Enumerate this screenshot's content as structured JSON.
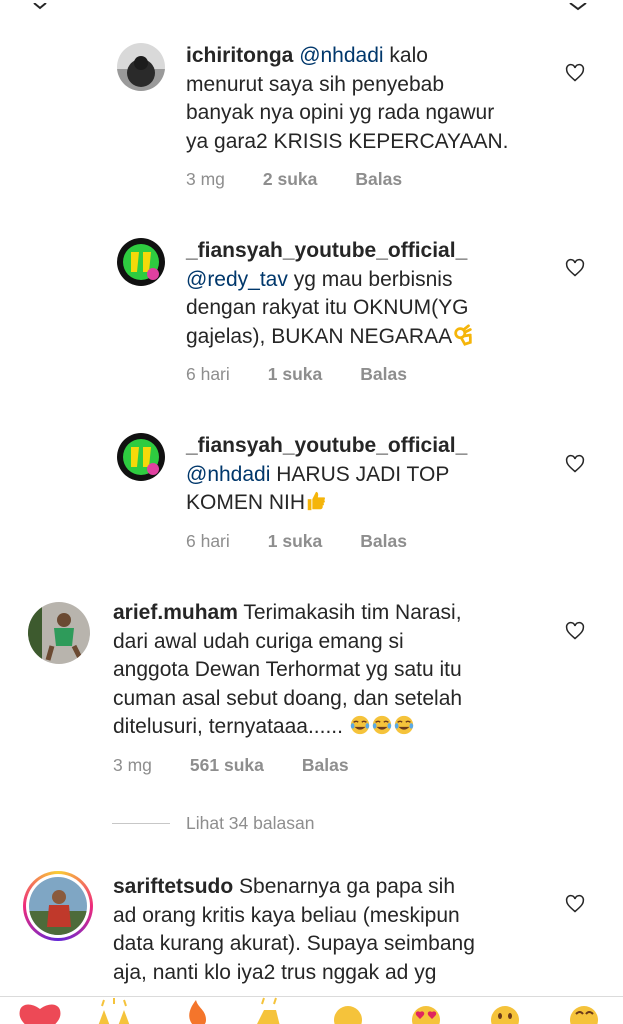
{
  "comments": [
    {
      "username": "ichiritonga",
      "mention": "@nhdadi",
      "text_lines": [
        " kalo",
        "menurut saya sih penyebab",
        "banyak nya opini yg rada ngawur",
        "ya gara2 KRISIS KEPERCAYAAN."
      ],
      "time": "3 mg",
      "likes": "2 suka",
      "reply": "Balas"
    },
    {
      "username": "_fiansyah_youtube_official_",
      "mention": "@redy_tav",
      "text_lines": [
        " yg mau berbisnis",
        "dengan rakyat itu OKNUM(YG",
        "gajelas), BUKAN NEGARAA"
      ],
      "time": "6 hari",
      "likes": "1 suka",
      "reply": "Balas"
    },
    {
      "username": "_fiansyah_youtube_official_",
      "mention": "@nhdadi",
      "text_lines": [
        " HARUS JADI TOP",
        "KOMEN NIH"
      ],
      "time": "6 hari",
      "likes": "1 suka",
      "reply": "Balas"
    },
    {
      "username": "arief.muham",
      "text_lines": [
        " Terimakasih tim Narasi,",
        "dari awal udah curiga emang si",
        "anggota Dewan Terhormat yg satu itu",
        "cuman asal sebut doang, dan setelah",
        "ditelusuri, ternyataaa......"
      ],
      "time": "3 mg",
      "likes": "561 suka",
      "reply": "Balas"
    },
    {
      "username": "sariftetsudo",
      "text_lines": [
        " Sbenarnya ga papa sih",
        "ad orang kritis kaya beliau (meskipun",
        "data kurang akurat). Supaya seimbang",
        "aja, nanti klo iya2 trus nggak ad yg"
      ]
    }
  ],
  "view_replies": "Lihat 34 balasan",
  "reactions": [
    "heart",
    "raised-hands",
    "fire",
    "clapping-hands",
    "crying-face",
    "heart-eyes-face",
    "open-mouth-face",
    "laughing-face"
  ],
  "colors": {
    "mention": "#00376b",
    "meta": "#8e8e8e",
    "heart_react": "#ed4956"
  }
}
